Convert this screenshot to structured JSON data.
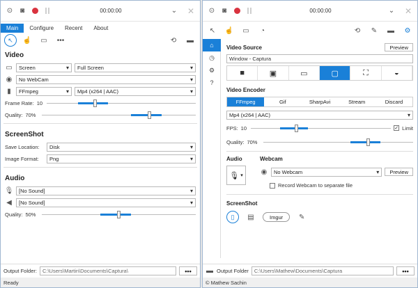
{
  "left": {
    "timer": "00:00:00",
    "tabs": [
      "Main",
      "Configure",
      "Recent",
      "About"
    ],
    "video": {
      "title": "Video",
      "source": "Screen",
      "source_mode": "Full Screen",
      "webcam": "No WebCam",
      "encoder": "FFmpeg",
      "format": "Mp4 (x264 | AAC)",
      "framerate_label": "Frame Rate:",
      "framerate": "10",
      "quality_label": "Quality:",
      "quality": "70%",
      "framerate_fraction": 0.33,
      "quality_fraction": 0.7
    },
    "screenshot": {
      "title": "ScreenShot",
      "save_label": "Save Location:",
      "save": "Disk",
      "format_label": "Image Format:",
      "format": "Png"
    },
    "audio": {
      "title": "Audio",
      "mic": "[No Sound]",
      "speaker": "[No Sound]",
      "quality_label": "Quality:",
      "quality": "50%",
      "quality_fraction": 0.5
    },
    "output_label": "Output Folder:",
    "output_path": "C:\\Users\\Martin\\Documents\\Captura\\",
    "more": "•••",
    "status": "Ready"
  },
  "right": {
    "timer": "00:00:00",
    "video_source": {
      "title": "Video Source",
      "preview": "Preview",
      "value": "Window - Captura"
    },
    "encoder": {
      "title": "Video Encoder",
      "tabs": [
        "FFmpeg",
        "Gif",
        "SharpAvi",
        "Stream",
        "Discard"
      ],
      "format": "Mp4 (x264 | AAC)",
      "fps_label": "FPS:",
      "fps": "10",
      "limit": "Limit",
      "quality_label": "Quality:",
      "quality": "70%",
      "fps_fraction": 0.33,
      "quality_fraction": 0.7
    },
    "audio_title": "Audio",
    "webcam": {
      "title": "Webcam",
      "value": "No Webcam",
      "preview": "Preview",
      "record_separate": "Record Webcam to separate file"
    },
    "screenshot": {
      "title": "ScreenShot",
      "imgur": "Imgur"
    },
    "output_label": "Output Folder",
    "output_path": "C:\\Users\\Mathew\\Documents\\Captura",
    "more": "•••",
    "status": "© Mathew Sachin"
  }
}
